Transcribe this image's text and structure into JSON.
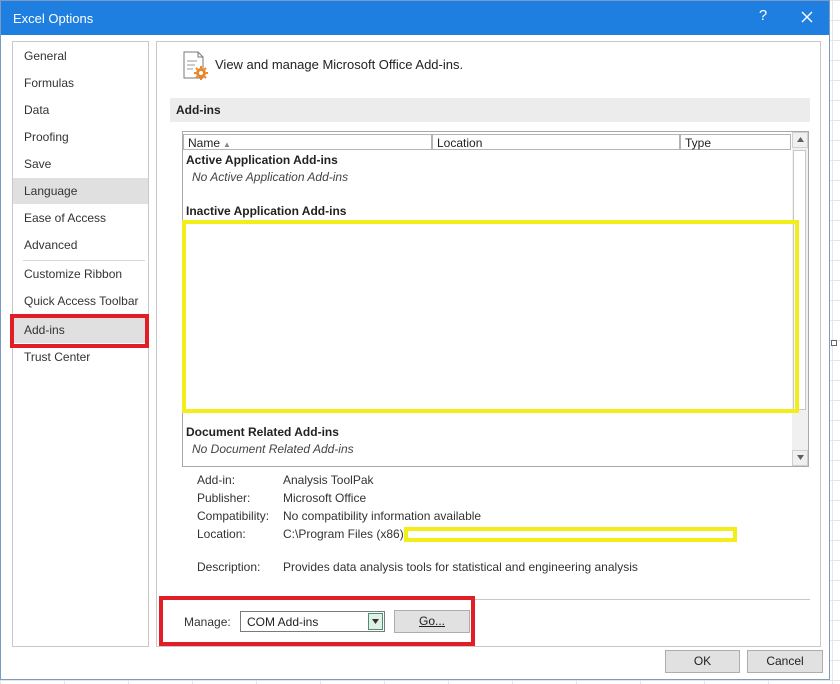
{
  "window": {
    "title": "Excel Options",
    "help_glyph": "?"
  },
  "nav": {
    "items": [
      {
        "label": "General"
      },
      {
        "label": "Formulas"
      },
      {
        "label": "Data"
      },
      {
        "label": "Proofing"
      },
      {
        "label": "Save"
      },
      {
        "label": "Language"
      },
      {
        "label": "Ease of Access"
      },
      {
        "label": "Advanced"
      },
      {
        "label": "Customize Ribbon"
      },
      {
        "label": "Quick Access Toolbar"
      },
      {
        "label": "Add-ins"
      },
      {
        "label": "Trust Center"
      }
    ],
    "selected": "Language",
    "highlighted": "Add-ins"
  },
  "header": {
    "icon": "addins-gear-icon",
    "text": "View and manage Microsoft Office Add-ins."
  },
  "section": {
    "title": "Add-ins"
  },
  "addins_list": {
    "columns": [
      "Name",
      "Location",
      "Type"
    ],
    "sort_indicator": "▲",
    "groups": {
      "active_title": "Active Application Add-ins",
      "active_empty": "No Active Application Add-ins",
      "inactive_title": "Inactive Application Add-ins",
      "document_title": "Document Related Add-ins",
      "document_empty": "No Document Related Add-ins"
    }
  },
  "details": {
    "addin_label": "Add-in:",
    "addin_value": "Analysis ToolPak",
    "publisher_label": "Publisher:",
    "publisher_value": "Microsoft Office",
    "compat_label": "Compatibility:",
    "compat_value": "No compatibility information available",
    "location_label": "Location:",
    "location_value": "C:\\Program Files (x86)\\",
    "description_label": "Description:",
    "description_value": "Provides data analysis tools for statistical and engineering analysis"
  },
  "manage": {
    "label": "Manage:",
    "selected": "COM Add-ins",
    "go_label": "Go..."
  },
  "footer": {
    "ok_label": "OK",
    "cancel_label": "Cancel"
  },
  "colors": {
    "titlebar": "#1e7fe0",
    "highlight_red": "#e11d25",
    "highlight_yellow": "#f3ee1a"
  }
}
